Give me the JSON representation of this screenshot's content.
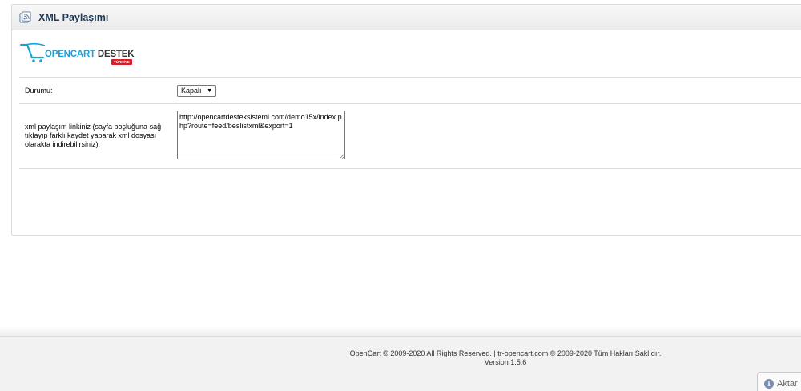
{
  "header": {
    "title": "XML Paylaşımı",
    "icon": "feed-icon"
  },
  "logo": {
    "text_a": "OPENCART",
    "text_b": " DESTEK",
    "sub": "TÜRKİYE"
  },
  "form": {
    "status_label": "Durumu:",
    "status_value": "Kapalı",
    "link_label": "xml paylaşım linkiniz (sayfa boşluğuna sağ tıklayıp farklı kaydet yaparak xml dosyası olarakta indirebilirsiniz):",
    "link_value": "http://opencartdesteksistemi.com/demo15x/index.php?route=feed/beslistxml&export=1"
  },
  "footer": {
    "opencart_link": "OpenCart",
    "rights_text": " © 2009-2020 All Rights Reserved. | ",
    "tr_link": "tr-opencart.com",
    "tr_rights": " © 2009-2020 Tüm Hakları Saklıdır.",
    "version": "Version 1.5.6"
  },
  "activate": {
    "label": "Aktar"
  },
  "colors": {
    "title": "#1d3a57",
    "logo_blue": "#1aa3d9",
    "logo_red": "#d81f26"
  }
}
